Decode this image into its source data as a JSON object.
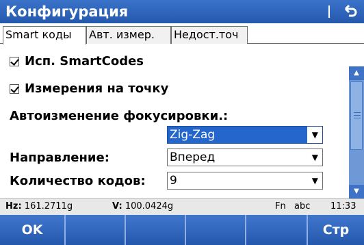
{
  "window": {
    "title": "Конфигурация",
    "back_icon": "back-arrow-icon"
  },
  "tabs": [
    {
      "label": "Smart коды",
      "active": true
    },
    {
      "label": "Авт. измер.",
      "active": false
    },
    {
      "label": "Недост.точ",
      "active": false
    }
  ],
  "form": {
    "use_smartcodes": {
      "label": "Исп. SmartCodes",
      "checked": true
    },
    "point_measure": {
      "label": "Измерения на точку",
      "checked": true
    },
    "autofocus": {
      "label": "Автоизменение фокусировки.:",
      "value": "Zig-Zag"
    },
    "direction": {
      "label": "Направление:",
      "value": "Вперед"
    },
    "code_count": {
      "label": "Количество кодов:",
      "value": "9"
    }
  },
  "status": {
    "hz_label": "Hz:",
    "hz_value": "161.2711g",
    "v_label": "V:",
    "v_value": "100.0424g",
    "fn": "Fn",
    "input_mode": "abc",
    "time": "11:33"
  },
  "softkeys": {
    "ok": "OK",
    "page": "Стр"
  },
  "colors": {
    "accent": "#2458ad",
    "selection": "#2466cc",
    "scrollbar": "#6f98d6"
  }
}
